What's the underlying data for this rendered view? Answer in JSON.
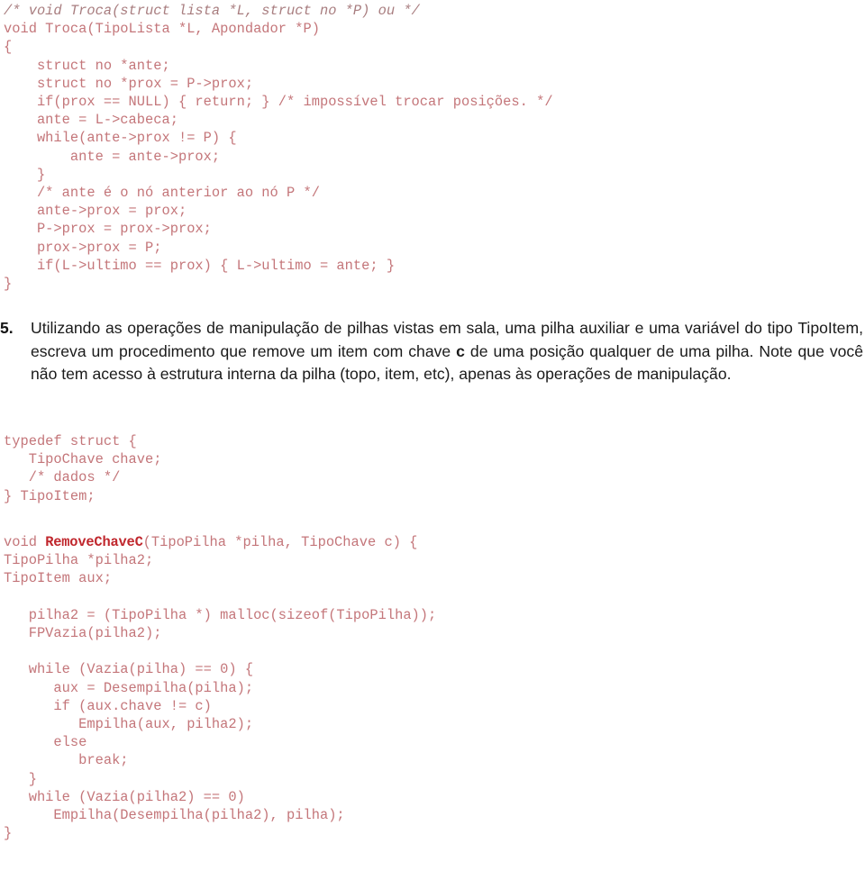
{
  "document": {
    "type": "exercise-handout",
    "language": "pt-BR",
    "colors": {
      "code_text": "#c4767a",
      "code_comment_italic": "#a87d7f",
      "code_identifier_bold": "#c0272d",
      "body_text": "#1a1a1a",
      "page_background": "#ffffff"
    }
  },
  "code_top": {
    "lines": [
      {
        "text": "/* void Troca(struct lista *L, struct no *P) ou */",
        "style": "italic"
      },
      {
        "text": "void Troca(TipoLista *L, Apondador *P)",
        "style": "normal"
      },
      {
        "text": "{",
        "style": "normal"
      },
      {
        "text": "    struct no *ante;",
        "style": "normal"
      },
      {
        "text": "    struct no *prox = P->prox;",
        "style": "normal"
      },
      {
        "text": "    if(prox == NULL) { return; } /* impossível trocar posições. */",
        "style": "normal"
      },
      {
        "text": "    ante = L->cabeca;",
        "style": "normal"
      },
      {
        "text": "    while(ante->prox != P) {",
        "style": "normal"
      },
      {
        "text": "        ante = ante->prox;",
        "style": "normal"
      },
      {
        "text": "    }",
        "style": "normal"
      },
      {
        "text": "    /* ante é o nó anterior ao nó P */",
        "style": "normal"
      },
      {
        "text": "    ante->prox = prox;",
        "style": "normal"
      },
      {
        "text": "    P->prox = prox->prox;",
        "style": "normal"
      },
      {
        "text": "    prox->prox = P;",
        "style": "normal"
      },
      {
        "text": "    if(L->ultimo == prox) { L->ultimo = ante; }",
        "style": "normal"
      },
      {
        "text": "}",
        "style": "normal"
      }
    ]
  },
  "question": {
    "number": "5.",
    "text_before_bold": "Utilizando as operações de manipulação de pilhas vistas em sala, uma pilha auxiliar e uma variável do tipo TipoItem, escreva um procedimento que remove um item com chave ",
    "bold_term": "c",
    "text_after_bold": " de uma posição qualquer de uma pilha. Note que você não tem acesso à estrutura interna da pilha (topo, item, etc), apenas às operações de manipulação."
  },
  "code_typedef": {
    "lines": [
      {
        "text": "typedef struct {",
        "style": "normal"
      },
      {
        "text": "   TipoChave chave;",
        "style": "normal"
      },
      {
        "text": "   /* dados */",
        "style": "normal"
      },
      {
        "text": "} TipoItem;",
        "style": "normal"
      }
    ]
  },
  "code_remove": {
    "signature": {
      "prefix": "void ",
      "name": "RemoveChaveC",
      "suffix": "(TipoPilha *pilha, TipoChave c) {"
    },
    "lines": [
      {
        "text": "TipoPilha *pilha2;",
        "style": "normal"
      },
      {
        "text": "TipoItem aux;",
        "style": "normal"
      },
      {
        "text": "",
        "style": "blank"
      },
      {
        "text": "   pilha2 = (TipoPilha *) malloc(sizeof(TipoPilha));",
        "style": "normal"
      },
      {
        "text": "   FPVazia(pilha2);",
        "style": "normal"
      },
      {
        "text": "",
        "style": "blank"
      },
      {
        "text": "   while (Vazia(pilha) == 0) {",
        "style": "normal"
      },
      {
        "text": "      aux = Desempilha(pilha);",
        "style": "normal"
      },
      {
        "text": "      if (aux.chave != c)",
        "style": "normal"
      },
      {
        "text": "         Empilha(aux, pilha2);",
        "style": "normal"
      },
      {
        "text": "      else",
        "style": "normal"
      },
      {
        "text": "         break;",
        "style": "normal"
      },
      {
        "text": "   }",
        "style": "normal"
      },
      {
        "text": "   while (Vazia(pilha2) == 0)",
        "style": "normal"
      },
      {
        "text": "      Empilha(Desempilha(pilha2), pilha);",
        "style": "normal"
      },
      {
        "text": "}",
        "style": "normal"
      }
    ]
  }
}
